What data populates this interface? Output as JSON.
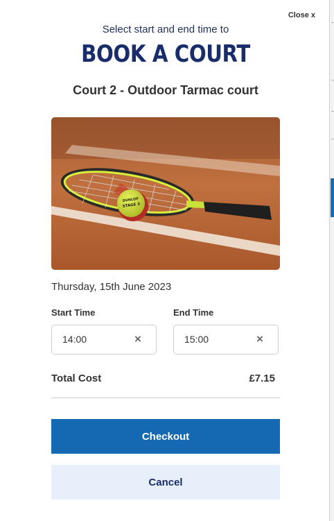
{
  "modal": {
    "close_label": "Close x",
    "subtitle": "Select start and end time to",
    "title": "BOOK A COURT",
    "court_name": "Court 2 - Outdoor Tarmac court",
    "image": {
      "subject": "tennis racket and ball on clay court",
      "ball_text": "DUNLOP STAGE 3"
    },
    "date": "Thursday, 15th June 2023",
    "start_time": {
      "label": "Start Time",
      "value": "14:00",
      "clear_icon": "×"
    },
    "end_time": {
      "label": "End Time",
      "value": "15:00",
      "clear_icon": "×"
    },
    "total_cost_label": "Total Cost",
    "total_cost_value": "£7.15",
    "checkout_label": "Checkout",
    "cancel_label": "Cancel"
  },
  "colors": {
    "primary": "#1469b2",
    "title": "#1a2d6b",
    "cancel_bg": "#e7f0fa"
  }
}
